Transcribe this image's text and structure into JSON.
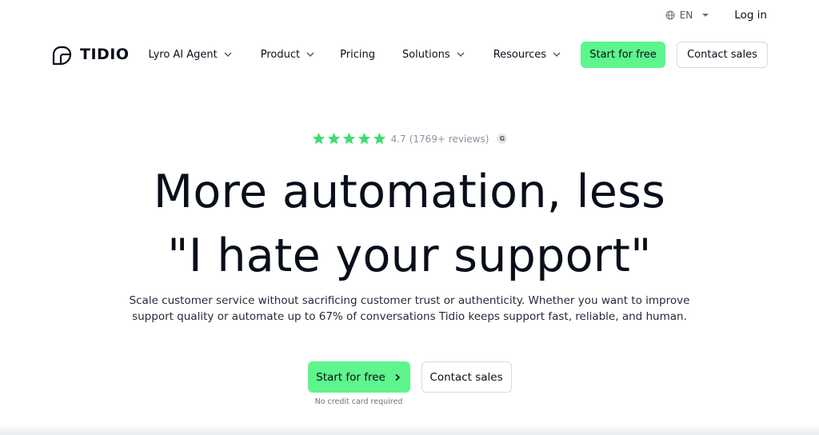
{
  "utility": {
    "language_icon": "globe-icon",
    "language": "EN",
    "login": "Log in"
  },
  "nav": {
    "logo_icon": "tidio-logo-icon",
    "logo_text": "TIDIO",
    "items": [
      {
        "label": "Lyro AI Agent",
        "has_dropdown": true
      },
      {
        "label": "Product",
        "has_dropdown": true
      },
      {
        "label": "Pricing",
        "has_dropdown": false
      },
      {
        "label": "Solutions",
        "has_dropdown": true
      },
      {
        "label": "Resources",
        "has_dropdown": true
      }
    ],
    "cta_primary": "Start for free",
    "cta_secondary": "Contact sales"
  },
  "hero": {
    "rating": {
      "stars": 5,
      "score": "4.7",
      "count": "(1769+ reviews)",
      "badge_icon": "g2-badge-icon",
      "badge_text": "G"
    },
    "headline_line1": "More automation, less",
    "headline_line2": "\"I hate your support\"",
    "subtitle_line1": "Scale customer service without sacrificing customer trust or authenticity. Whether you want to improve",
    "subtitle_line2": "support quality or automate up to 67% of conversations Tidio keeps support fast, reliable, and human.",
    "cta_primary": "Start for free",
    "cta_secondary": "Contact sales",
    "cta_note": "No credit card required"
  },
  "colors": {
    "accent_green": "#5df58c",
    "star_green": "#3ddc71",
    "text_dark": "#080f1a",
    "muted": "#8a93a0"
  }
}
